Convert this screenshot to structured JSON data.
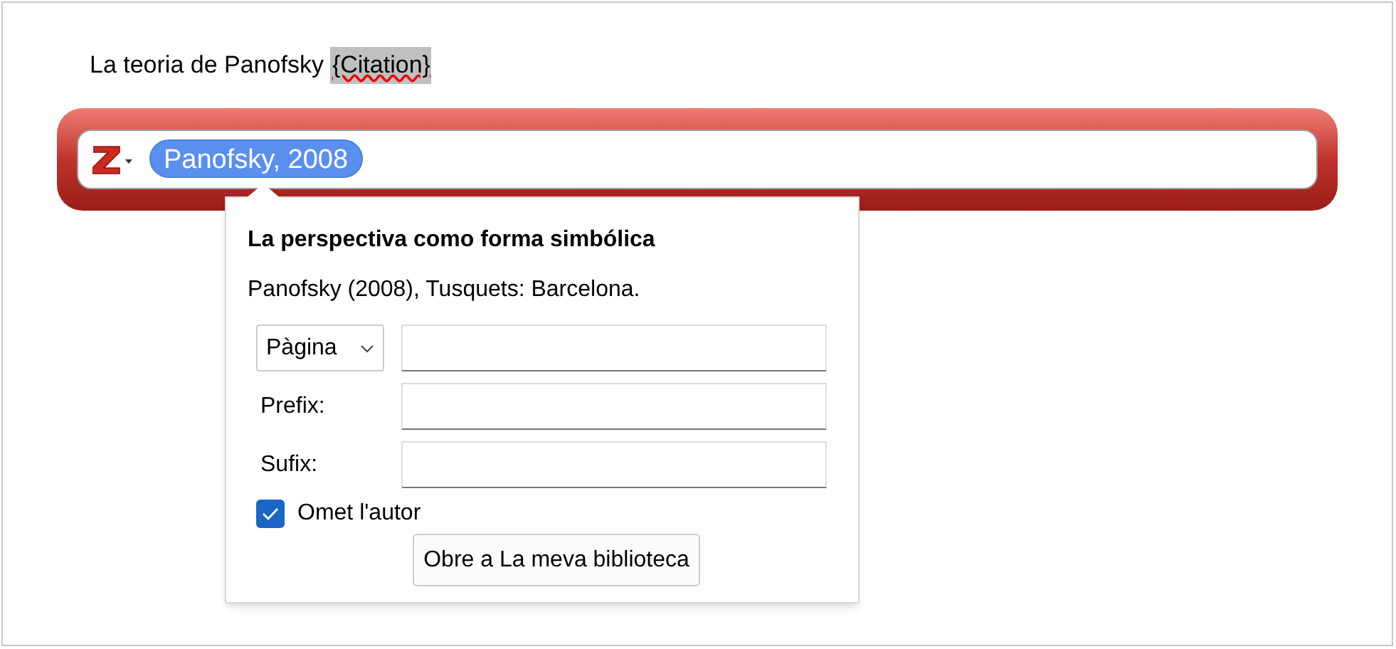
{
  "document": {
    "text": "La teoria de Panofsky",
    "field": "{Citation}"
  },
  "citation_bar": {
    "citations": [
      {
        "label": "Panofsky, 2008",
        "selected": true
      }
    ]
  },
  "popup": {
    "title": "La perspectiva como forma simbólica",
    "details": "Panofsky (2008), Tusquets: Barcelona.",
    "locator": {
      "label": "Pàgina"
    },
    "prefix_label": "Prefix:",
    "suffix_label": "Sufix:",
    "omit_author": {
      "label": "Omet l'autor",
      "checked": true
    },
    "button": "Obre a La meva biblioteca"
  }
}
